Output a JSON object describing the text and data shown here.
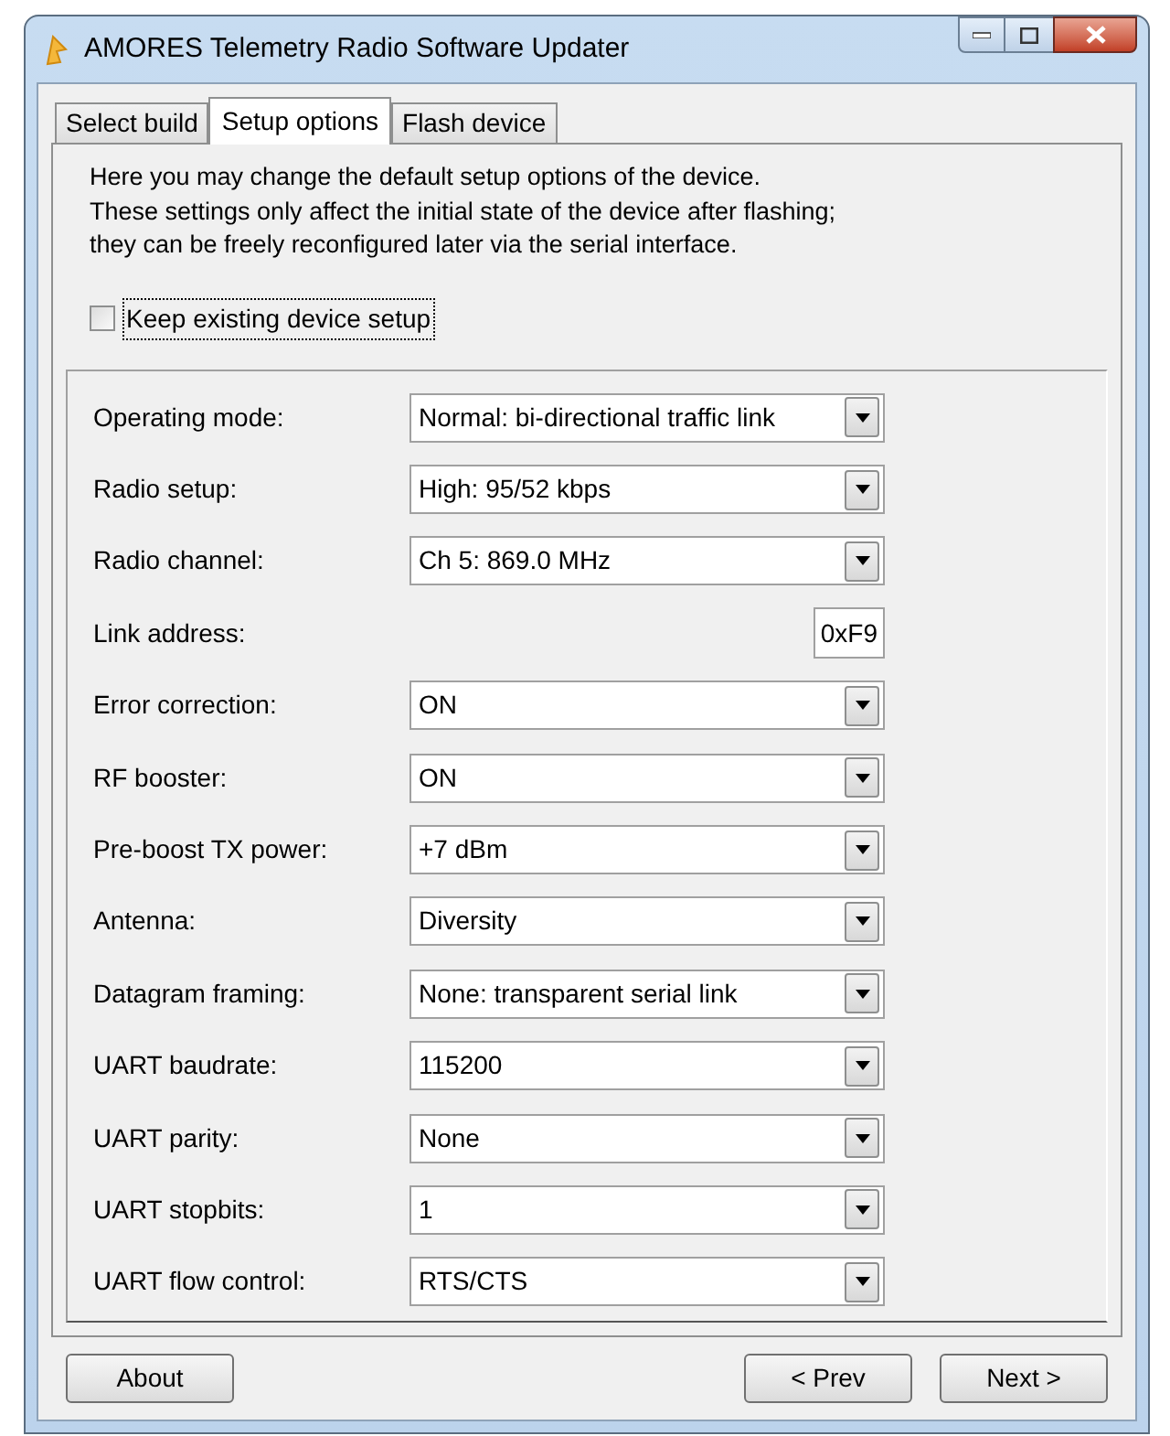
{
  "window": {
    "title": "AMORES Telemetry Radio Software Updater"
  },
  "tabs": [
    {
      "label": "Select build",
      "selected": false
    },
    {
      "label": "Setup options",
      "selected": true
    },
    {
      "label": "Flash device",
      "selected": false
    }
  ],
  "intro": [
    "Here you may change the default setup options of the device.",
    "These settings only affect the initial state of the device after flashing;",
    "they can be freely reconfigured later via the serial interface."
  ],
  "keep_setup": {
    "label": "Keep existing device setup",
    "checked": false
  },
  "settings": [
    {
      "label": "Operating mode:",
      "kind": "combo",
      "value": "Normal: bi-directional traffic link"
    },
    {
      "label": "Radio setup:",
      "kind": "combo",
      "value": "High: 95/52 kbps"
    },
    {
      "label": "Radio channel:",
      "kind": "combo",
      "value": "Ch 5: 869.0 MHz"
    },
    {
      "label": "Link address:",
      "kind": "text",
      "value": "0xF9"
    },
    {
      "label": "Error correction:",
      "kind": "combo",
      "value": "ON"
    },
    {
      "label": "RF booster:",
      "kind": "combo",
      "value": "ON"
    },
    {
      "label": "Pre-boost TX power:",
      "kind": "combo",
      "value": "+7 dBm"
    },
    {
      "label": "Antenna:",
      "kind": "combo",
      "value": "Diversity"
    },
    {
      "label": "Datagram framing:",
      "kind": "combo",
      "value": "None: transparent serial link"
    },
    {
      "label": "UART baudrate:",
      "kind": "combo",
      "value": "115200"
    },
    {
      "label": "UART parity:",
      "kind": "combo",
      "value": "None"
    },
    {
      "label": "UART stopbits:",
      "kind": "combo",
      "value": "1"
    },
    {
      "label": "UART flow control:",
      "kind": "combo",
      "value": "RTS/CTS"
    }
  ],
  "buttons": {
    "about": "About",
    "prev": "< Prev",
    "next": "Next >"
  }
}
